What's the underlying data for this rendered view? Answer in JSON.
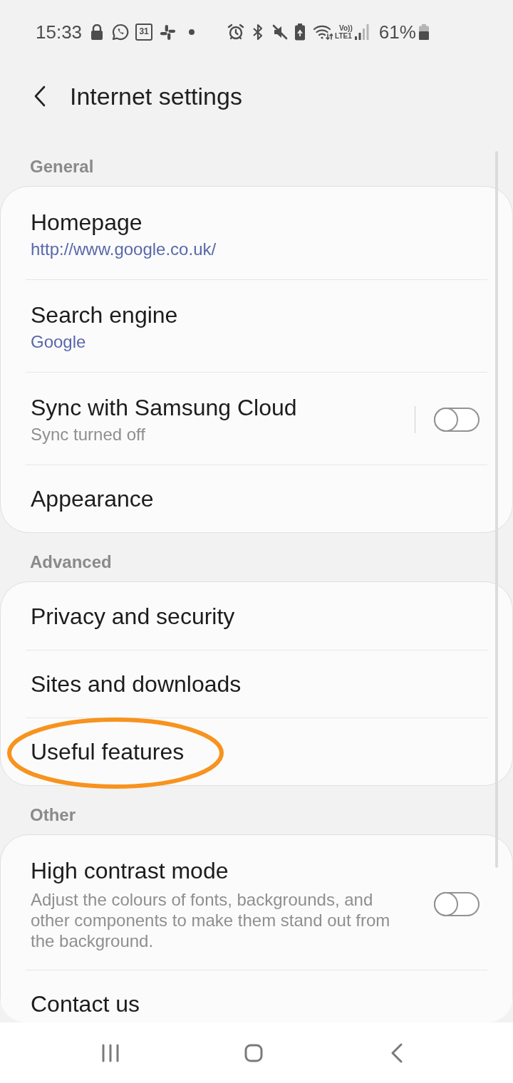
{
  "status_bar": {
    "time": "15:33",
    "calendar_day": "31",
    "volte": "Vo))",
    "network": "LTE1",
    "battery": "61%"
  },
  "header": {
    "title": "Internet settings"
  },
  "sections": [
    {
      "title": "General",
      "items": [
        {
          "kind": "value",
          "title": "Homepage",
          "value": "http://www.google.co.uk/"
        },
        {
          "kind": "value",
          "title": "Search engine",
          "value": "Google"
        },
        {
          "kind": "split_switch",
          "title": "Sync with Samsung Cloud",
          "summary": "Sync turned off",
          "on": false
        },
        {
          "kind": "plain",
          "title": "Appearance"
        }
      ]
    },
    {
      "title": "Advanced",
      "items": [
        {
          "kind": "plain",
          "title": "Privacy and security",
          "circled": false
        },
        {
          "kind": "plain",
          "title": "Sites and downloads",
          "circled": false
        },
        {
          "kind": "plain",
          "title": "Useful features",
          "circled": true
        }
      ]
    },
    {
      "title": "Other",
      "items": [
        {
          "kind": "switch",
          "title": "High contrast mode",
          "summary": "Adjust the colours of fonts, backgrounds, and other components to make them stand out from the background.",
          "on": false
        },
        {
          "kind": "plain",
          "title": "Contact us"
        }
      ]
    }
  ]
}
